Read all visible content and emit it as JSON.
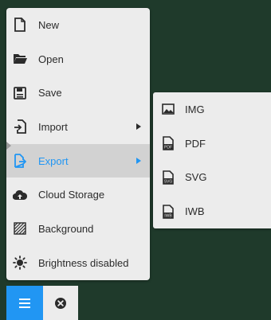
{
  "menu": {
    "items": [
      {
        "label": "New",
        "icon": "file-icon"
      },
      {
        "label": "Open",
        "icon": "folder-open-icon"
      },
      {
        "label": "Save",
        "icon": "save-icon"
      },
      {
        "label": "Import",
        "icon": "import-icon"
      },
      {
        "label": "Export",
        "icon": "export-icon",
        "active": true
      },
      {
        "label": "Cloud Storage",
        "icon": "cloud-upload-icon"
      },
      {
        "label": "Background",
        "icon": "background-pattern-icon"
      },
      {
        "label": "Brightness disabled",
        "icon": "brightness-icon"
      }
    ]
  },
  "submenu": {
    "items": [
      {
        "label": "IMG",
        "icon": "image-icon"
      },
      {
        "label": "PDF",
        "icon": "pdf-file-icon"
      },
      {
        "label": "SVG",
        "icon": "svg-file-icon"
      },
      {
        "label": "IWB",
        "icon": "iwb-file-icon"
      }
    ]
  },
  "toolbar": {
    "menu_icon": "hamburger-menu-icon",
    "close_icon": "close-circle-icon"
  },
  "colors": {
    "background": "#1f3a2b",
    "panel": "#ececec",
    "accent": "#2196f3",
    "active_row": "#d2d2d2",
    "text": "#2b2b2b"
  }
}
